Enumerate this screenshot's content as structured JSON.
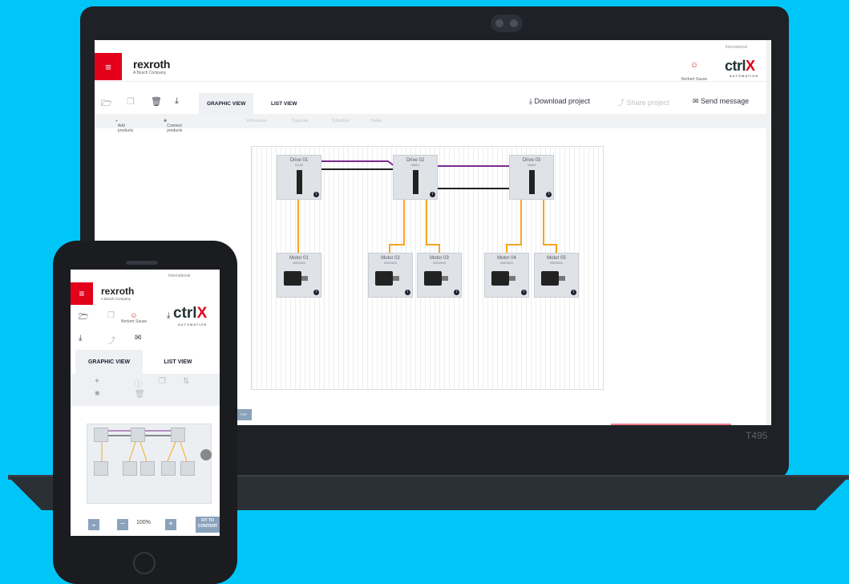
{
  "laptop": {
    "model": "T495",
    "header": {
      "region": "International",
      "brand": "rexroth",
      "brand_sub": "A Bosch Company",
      "user": "Norbert Sause",
      "product_logo": "ctrl",
      "product_logo_x": "X",
      "product_sub": "AUTOMATION"
    },
    "toolbar": {
      "tabs": [
        "GRAPHIC VIEW",
        "LIST VIEW"
      ],
      "actions": [
        "Download project",
        "Share project",
        "Send message"
      ]
    },
    "subbar": {
      "add": "Add products",
      "connect": "Connect products",
      "disabled": [
        "Information",
        "Duplicate",
        "Substitute",
        "Delete"
      ]
    },
    "diagram": {
      "drives": [
        {
          "name": "Drive 01",
          "model": "XCS2"
        },
        {
          "name": "Drive 02",
          "model": "XMD1"
        },
        {
          "name": "Drive 03",
          "model": "XMD1"
        }
      ],
      "motors": [
        {
          "name": "Motor 01",
          "model": "MS2N03"
        },
        {
          "name": "Motor 02",
          "model": "MS2N03"
        },
        {
          "name": "Motor 03",
          "model": "MS2N03"
        },
        {
          "name": "Motor 04",
          "model": "MS2N03"
        },
        {
          "name": "Motor 05",
          "model": "MS2N03"
        }
      ],
      "connection_colors": {
        "bus": "#7b2a8c",
        "power": "#222222",
        "motor_cable": "#f5a623"
      }
    },
    "export_label": "PDF"
  },
  "phone": {
    "region": "International",
    "brand": "rexroth",
    "brand_sub": "A Bosch Company",
    "user": "Norbert Sause",
    "product_logo": "ctrl",
    "product_logo_x": "X",
    "product_sub": "AUTOMATION",
    "tabs": [
      "GRAPHIC VIEW",
      "LIST VIEW"
    ],
    "zoom": "100%",
    "fit": "FIT TO CONTENT"
  }
}
